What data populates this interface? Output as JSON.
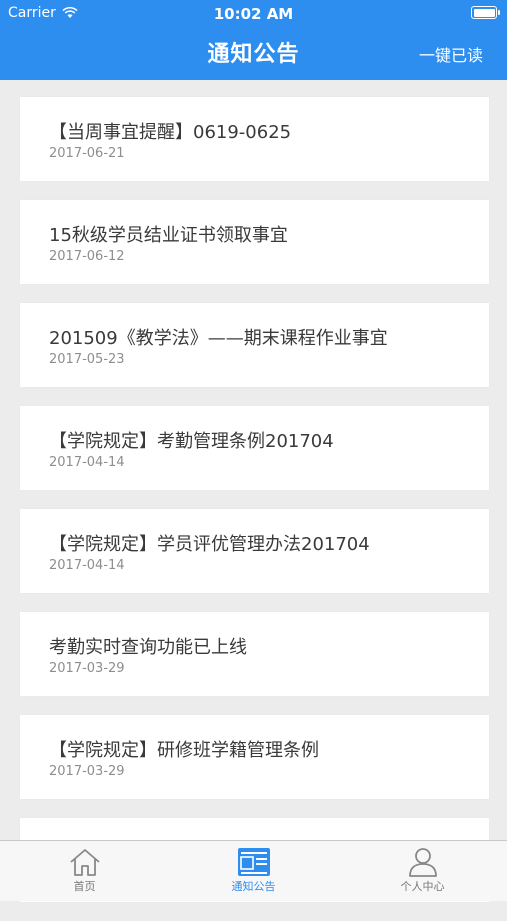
{
  "status_bar": {
    "carrier": "Carrier",
    "time": "10:02 AM"
  },
  "header": {
    "title": "通知公告",
    "mark_all_read": "一键已读"
  },
  "notices": [
    {
      "title": "【当周事宜提醒】0619-0625",
      "date": "2017-06-21"
    },
    {
      "title": "15秋级学员结业证书领取事宜",
      "date": "2017-06-12"
    },
    {
      "title": "201509《教学法》——期末课程作业事宜",
      "date": "2017-05-23"
    },
    {
      "title": "【学院规定】考勤管理条例201704",
      "date": "2017-04-14"
    },
    {
      "title": "【学院规定】学员评优管理办法201704",
      "date": "2017-04-14"
    },
    {
      "title": "考勤实时查询功能已上线",
      "date": "2017-03-29"
    },
    {
      "title": "【学院规定】研修班学籍管理条例",
      "date": "2017-03-29"
    }
  ],
  "tabbar": [
    {
      "label": "首页",
      "icon": "home-icon",
      "active": false
    },
    {
      "label": "通知公告",
      "icon": "notice-board-icon",
      "active": true
    },
    {
      "label": "个人中心",
      "icon": "person-icon",
      "active": false
    }
  ],
  "colors": {
    "accent": "#2e8ef0",
    "background": "#ececec",
    "card": "#ffffff"
  }
}
